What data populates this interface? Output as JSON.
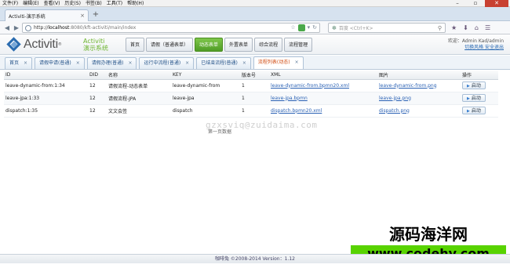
{
  "browser": {
    "menu": [
      "文件(F)",
      "编辑(E)",
      "查看(V)",
      "历史(S)",
      "书签(B)",
      "工具(T)",
      "帮助(H)"
    ],
    "tab_title": "Activiti-演示系统",
    "url_host": "localhost",
    "url_rest": ":8080/kft-activiti/main/index",
    "search_placeholder": "百度 <Ctrl+K>"
  },
  "app": {
    "logo_text": "Activiti",
    "logo_reg": "®",
    "title_line1": "Activiti",
    "title_line2": "演示系统",
    "menu": [
      {
        "label": "首页",
        "active": false
      },
      {
        "label": "请假（普通表单）",
        "active": false
      },
      {
        "label": "动态表单",
        "active": true
      },
      {
        "label": "外置表单",
        "active": false
      },
      {
        "label": "综合流程",
        "active": false
      },
      {
        "label": "流程管理",
        "active": false
      }
    ],
    "user_greeting": "欢迎：Admin Kad/admin",
    "user_links": "切换风格 安全退出"
  },
  "content_tabs": [
    {
      "label": "首页",
      "active": false
    },
    {
      "label": "请假申请(普通)",
      "active": false
    },
    {
      "label": "请假办理(普通)",
      "active": false
    },
    {
      "label": "运行中流程(普通)",
      "active": false
    },
    {
      "label": "已结束流程(普通)",
      "active": false
    },
    {
      "label": "流程列表(动态)",
      "active": true
    }
  ],
  "table": {
    "headers": [
      "ID",
      "DID",
      "名称",
      "KEY",
      "版本号",
      "XML",
      "图片",
      "操作"
    ],
    "rows": [
      {
        "id": "leave-dynamic-from:1:34",
        "did": "12",
        "name": "请假流程-动态表单",
        "key": "leave-dynamic-from",
        "version": "1",
        "xml": "leave-dynamic-from.bpmn20.xml",
        "image": "leave-dynamic-from.png",
        "action": "启动"
      },
      {
        "id": "leave-jpa:1:33",
        "did": "12",
        "name": "请假流程-JPA",
        "key": "leave-jpa",
        "version": "1",
        "xml": "leave-jpa.bpmn",
        "image": "leave-jpa.png",
        "action": "启动"
      },
      {
        "id": "dispatch:1:35",
        "did": "12",
        "name": "文文会签",
        "key": "dispatch",
        "version": "1",
        "xml": "dispatch.bpmn20.xml",
        "image": "dispatch.png",
        "action": "启动"
      }
    ]
  },
  "pager_text": "第一页数据",
  "watermark_text": "gzxsviq@zuidaima.com",
  "footer_text": "咖啡兔 ©2008-2014 Version：1.12",
  "brand": {
    "cn": "源码海洋网",
    "url": "www.codehy.com"
  }
}
